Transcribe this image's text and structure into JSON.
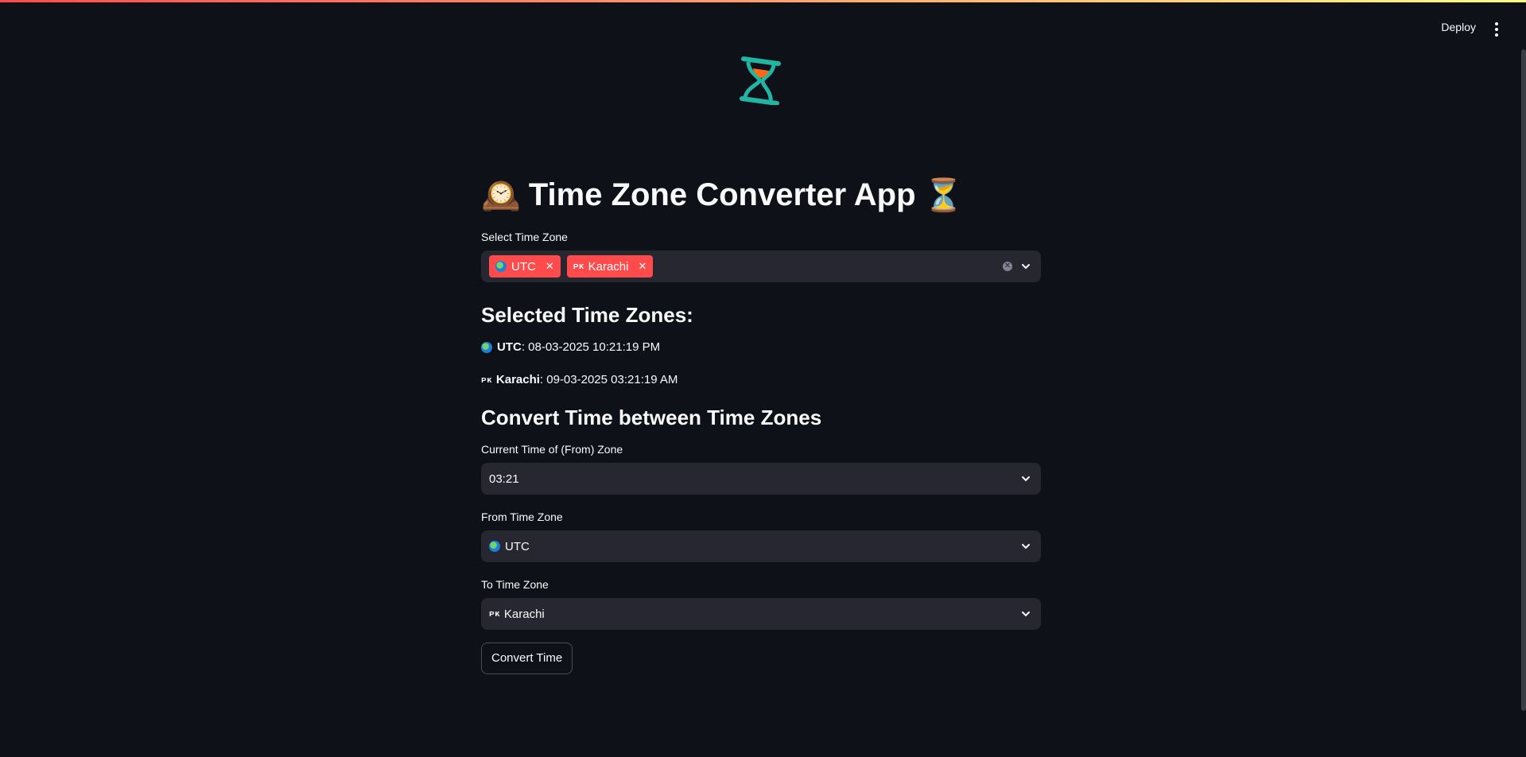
{
  "header": {
    "deploy_label": "Deploy"
  },
  "app": {
    "title": "Time Zone Converter App",
    "title_left_emoji": "🕰️",
    "title_right_emoji": "⏳"
  },
  "select_tz": {
    "label": "Select Time Zone",
    "chips": [
      {
        "flag": "globe-icon",
        "label": "UTC"
      },
      {
        "flag": "ᴘᴋ",
        "label": "Karachi"
      }
    ]
  },
  "selected": {
    "heading": "Selected Time Zones:",
    "items": [
      {
        "flag": "globe-icon",
        "name": "UTC",
        "time": ": 08-03-2025 10:21:19 PM"
      },
      {
        "flag": "ᴘᴋ",
        "name": "Karachi",
        "time": ": 09-03-2025 03:21:19 AM"
      }
    ]
  },
  "convert": {
    "heading": "Convert Time between Time Zones",
    "current_time_label": "Current Time of (From) Zone",
    "current_time_value": "03:21",
    "from_label": "From Time Zone",
    "from_value": "UTC",
    "to_label": "To Time Zone",
    "to_flag": "ᴘᴋ",
    "to_value": "Karachi",
    "button_label": "Convert Time"
  },
  "colors": {
    "background": "#0e1117",
    "input_bg": "#262730",
    "chip_red": "#ff4b4b",
    "logo_teal": "#21b5a4",
    "logo_orange": "#ff6a13"
  }
}
